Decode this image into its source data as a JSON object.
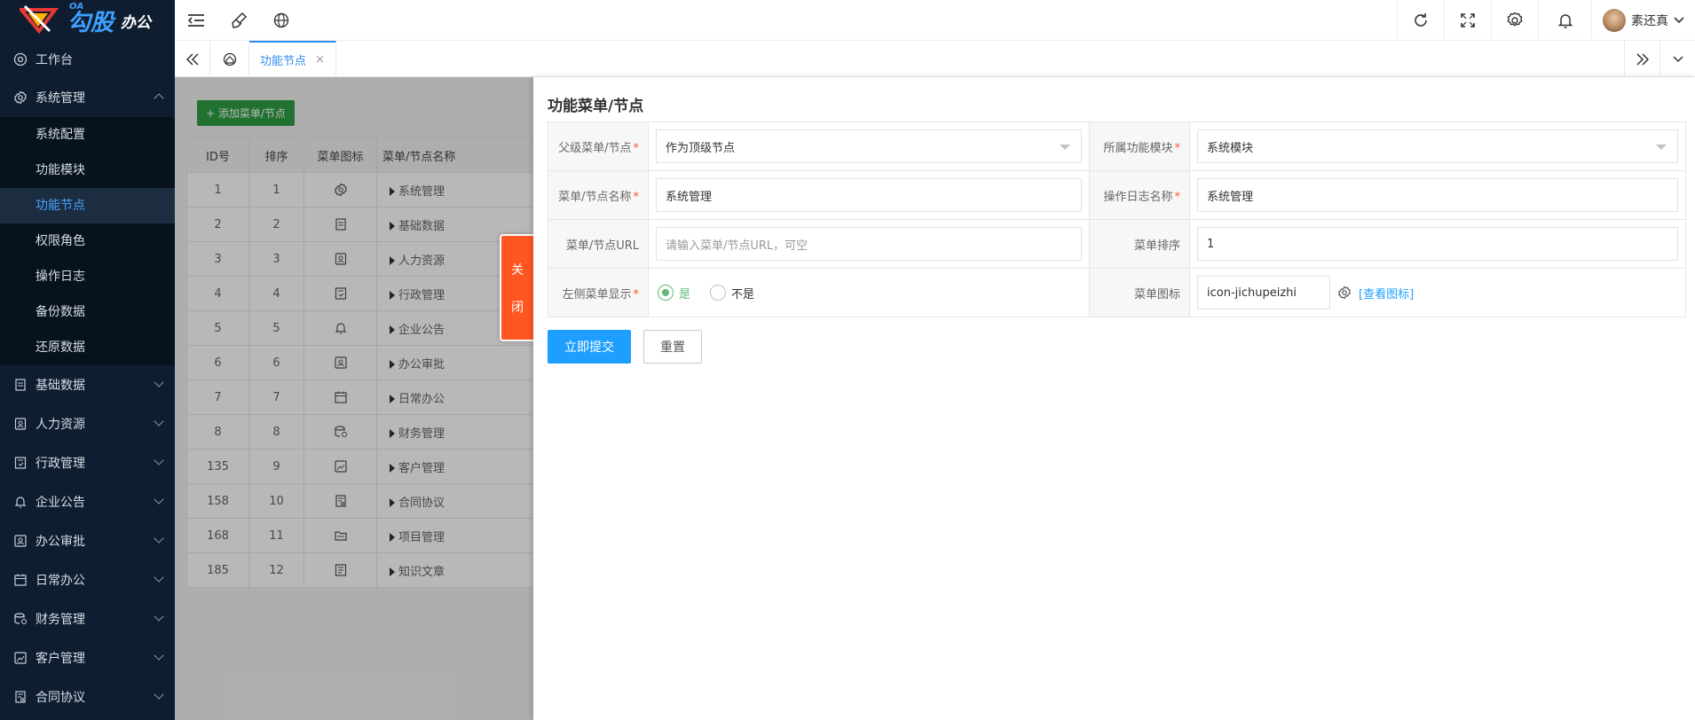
{
  "brand": {
    "oa": "OA",
    "name": "勾股",
    "suffix": "办公"
  },
  "sidebar": {
    "workbench": "工作台",
    "system": {
      "label": "系统管理",
      "children": [
        "系统配置",
        "功能模块",
        "功能节点",
        "权限角色",
        "操作日志",
        "备份数据",
        "还原数据"
      ],
      "active": "功能节点"
    },
    "groups": [
      "基础数据",
      "人力资源",
      "行政管理",
      "企业公告",
      "办公审批",
      "日常办公",
      "财务管理",
      "客户管理",
      "合同协议"
    ]
  },
  "topbar": {
    "user_name": "素还真"
  },
  "tabs": [
    {
      "label": "功能节点",
      "close": "×"
    }
  ],
  "list": {
    "add_button": "+ 添加菜单/节点",
    "headers": [
      "ID号",
      "排序",
      "菜单图标",
      "菜单/节点名称"
    ],
    "rows": [
      {
        "id": "1",
        "sort": "1",
        "icon": "gear-icon",
        "name": "系统管理"
      },
      {
        "id": "2",
        "sort": "2",
        "icon": "doc-icon",
        "name": "基础数据"
      },
      {
        "id": "3",
        "sort": "3",
        "icon": "person-card-icon",
        "name": "人力资源"
      },
      {
        "id": "4",
        "sort": "4",
        "icon": "admin-icon",
        "name": "行政管理"
      },
      {
        "id": "5",
        "sort": "5",
        "icon": "bell-icon",
        "name": "企业公告"
      },
      {
        "id": "6",
        "sort": "6",
        "icon": "approval-icon",
        "name": "办公审批"
      },
      {
        "id": "7",
        "sort": "7",
        "icon": "calendar-icon",
        "name": "日常办公"
      },
      {
        "id": "8",
        "sort": "8",
        "icon": "finance-icon",
        "name": "财务管理"
      },
      {
        "id": "135",
        "sort": "9",
        "icon": "customer-icon",
        "name": "客户管理"
      },
      {
        "id": "158",
        "sort": "10",
        "icon": "contract-icon",
        "name": "合同协议"
      },
      {
        "id": "168",
        "sort": "11",
        "icon": "folder-icon",
        "name": "项目管理"
      },
      {
        "id": "185",
        "sort": "12",
        "icon": "article-icon",
        "name": "知识文章"
      }
    ]
  },
  "close_tab": {
    "line1": "关",
    "line2": "闭"
  },
  "form": {
    "title": "功能菜单/节点",
    "parent_label": "父级菜单/节点",
    "parent_value": "作为顶级节点",
    "module_label": "所属功能模块",
    "module_value": "系统模块",
    "name_label": "菜单/节点名称",
    "name_value": "系统管理",
    "log_label": "操作日志名称",
    "log_value": "系统管理",
    "url_label": "菜单/节点URL",
    "url_placeholder": "请输入菜单/节点URL，可空",
    "sort_label": "菜单排序",
    "sort_value": "1",
    "show_label": "左侧菜单显示",
    "show_yes": "是",
    "show_no": "不是",
    "icon_label": "菜单图标",
    "icon_value": "icon-jichupeizhi",
    "view_icons": "[查看图标]",
    "submit": "立即提交",
    "reset": "重置",
    "required_mark": "*"
  },
  "colors": {
    "accent": "#1e9fff",
    "sidebar_bg": "#0e1e30",
    "close_tab": "#ff5722",
    "add_button": "#2f9e44",
    "radio_on": "#5fb878"
  }
}
